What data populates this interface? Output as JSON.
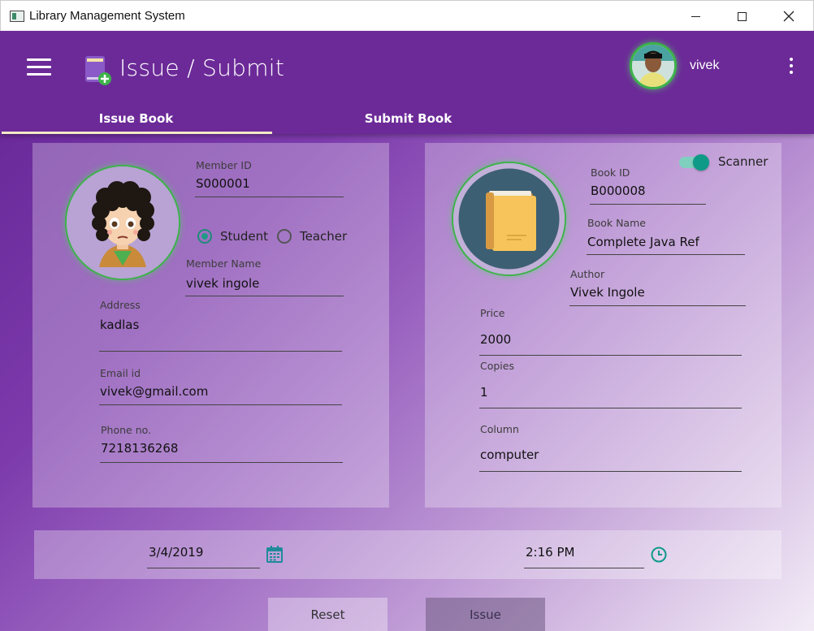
{
  "window": {
    "title": "Library Management System"
  },
  "header": {
    "title": "Issue / Submit",
    "username": "vivek"
  },
  "tabs": [
    {
      "label": "Issue Book",
      "active": true
    },
    {
      "label": "Submit Book",
      "active": false
    }
  ],
  "member": {
    "member_id_label": "Member ID",
    "member_id": "S000001",
    "type_options": {
      "student": "Student",
      "teacher": "Teacher",
      "selected": "Student"
    },
    "name_label": "Member Name",
    "name": "vivek ingole",
    "address_label": "Address",
    "address": "kadlas",
    "email_label": "Email id",
    "email": "vivek@gmail.com",
    "phone_label": "Phone no.",
    "phone": "7218136268"
  },
  "book": {
    "scanner_label": "Scanner",
    "scanner_on": true,
    "book_id_label": "Book ID",
    "book_id": "B000008",
    "name_label": "Book Name",
    "name": "Complete Java Ref",
    "author_label": "Author",
    "author": "Vivek Ingole",
    "price_label": "Price",
    "price": "2000",
    "copies_label": "Copies",
    "copies": "1",
    "column_label": "Column",
    "column": "computer"
  },
  "issue": {
    "date": "3/4/2019",
    "time": "2:16 PM"
  },
  "actions": {
    "reset": "Reset",
    "issue": "Issue"
  },
  "colors": {
    "header": "#6c2a98",
    "accent_green": "#3db24a",
    "teal": "#0e9a86"
  }
}
